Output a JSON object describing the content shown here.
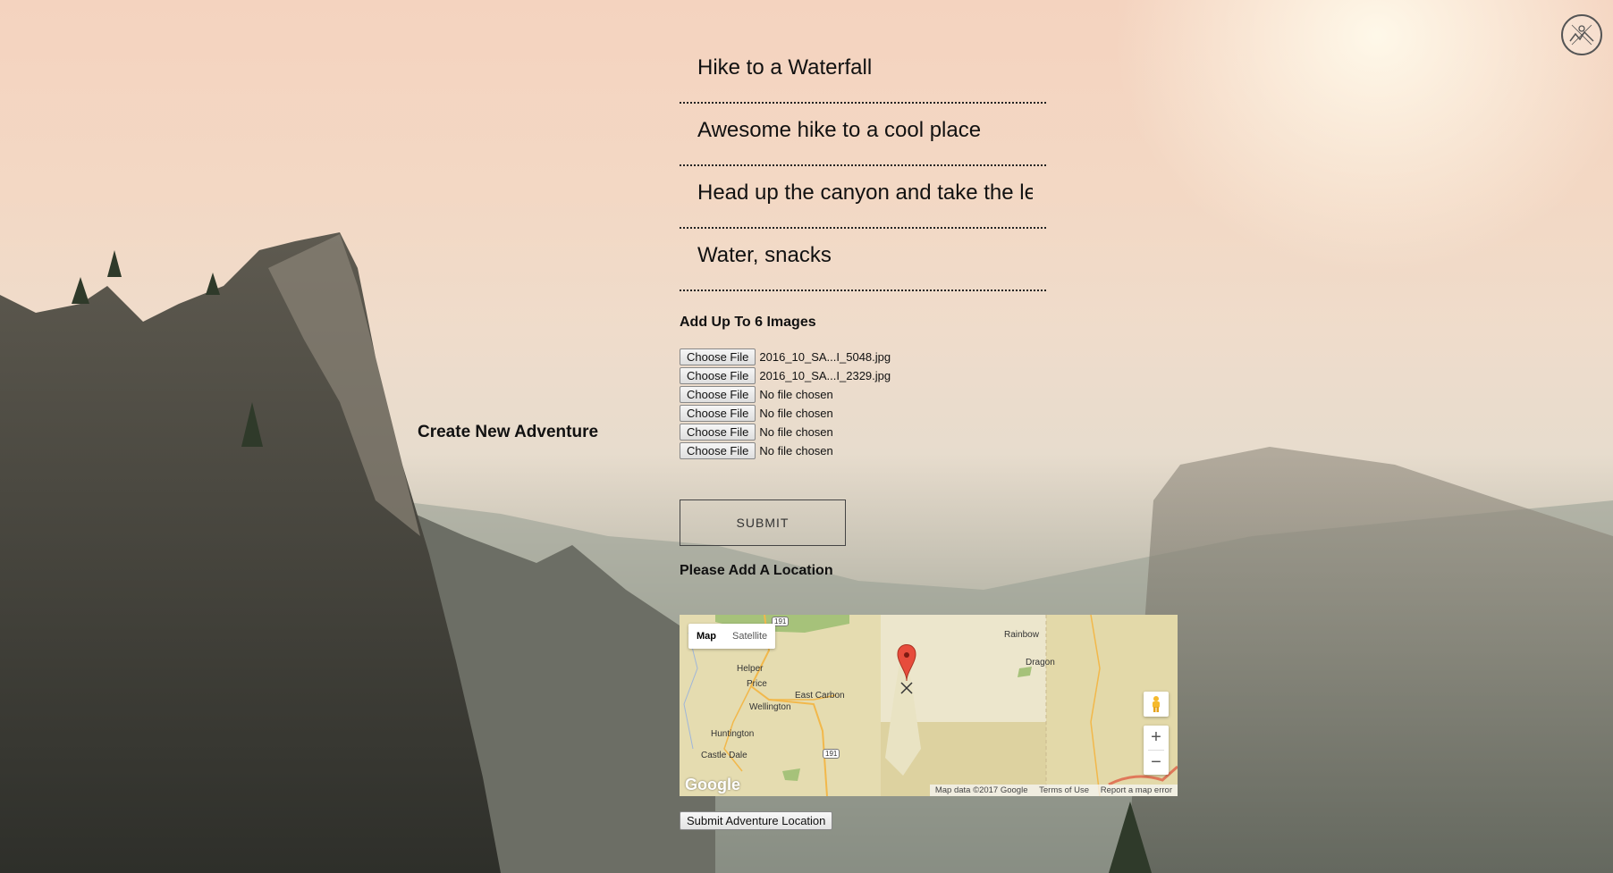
{
  "page": {
    "title": "Create New Adventure"
  },
  "form": {
    "fields": [
      {
        "value": "Hike to a Waterfall"
      },
      {
        "value": "Awesome hike to a cool place"
      },
      {
        "value": "Head up the canyon and take the le"
      },
      {
        "value": "Water, snacks"
      }
    ],
    "images_label": "Add Up To 6 Images",
    "file_inputs": [
      {
        "button": "Choose File",
        "status": "2016_10_SA...I_5048.jpg"
      },
      {
        "button": "Choose File",
        "status": "2016_10_SA...I_2329.jpg"
      },
      {
        "button": "Choose File",
        "status": "No file chosen"
      },
      {
        "button": "Choose File",
        "status": "No file chosen"
      },
      {
        "button": "Choose File",
        "status": "No file chosen"
      },
      {
        "button": "Choose File",
        "status": "No file chosen"
      }
    ],
    "submit_label": "SUBMIT",
    "location_label": "Please Add A Location",
    "location_button": "Submit Adventure Location"
  },
  "map": {
    "type_buttons": [
      "Map",
      "Satellite"
    ],
    "places": [
      "Helper",
      "Price",
      "Wellington",
      "East Carbon",
      "Huntington",
      "Castle Dale",
      "Rainbow",
      "Dragon"
    ],
    "highway_labels": [
      "191",
      "191"
    ],
    "zoom_in": "+",
    "zoom_out": "−",
    "logo": "Google",
    "attribution": [
      "Map data ©2017 Google",
      "Terms of Use",
      "Report a map error"
    ],
    "colors": {
      "land": "#e5dcb0",
      "marker": "#e74c3c",
      "road": "#f2b84b"
    }
  },
  "icons": {
    "logo": "mountain-badge-icon",
    "marker": "map-pin-icon",
    "pegman": "street-view-icon"
  }
}
